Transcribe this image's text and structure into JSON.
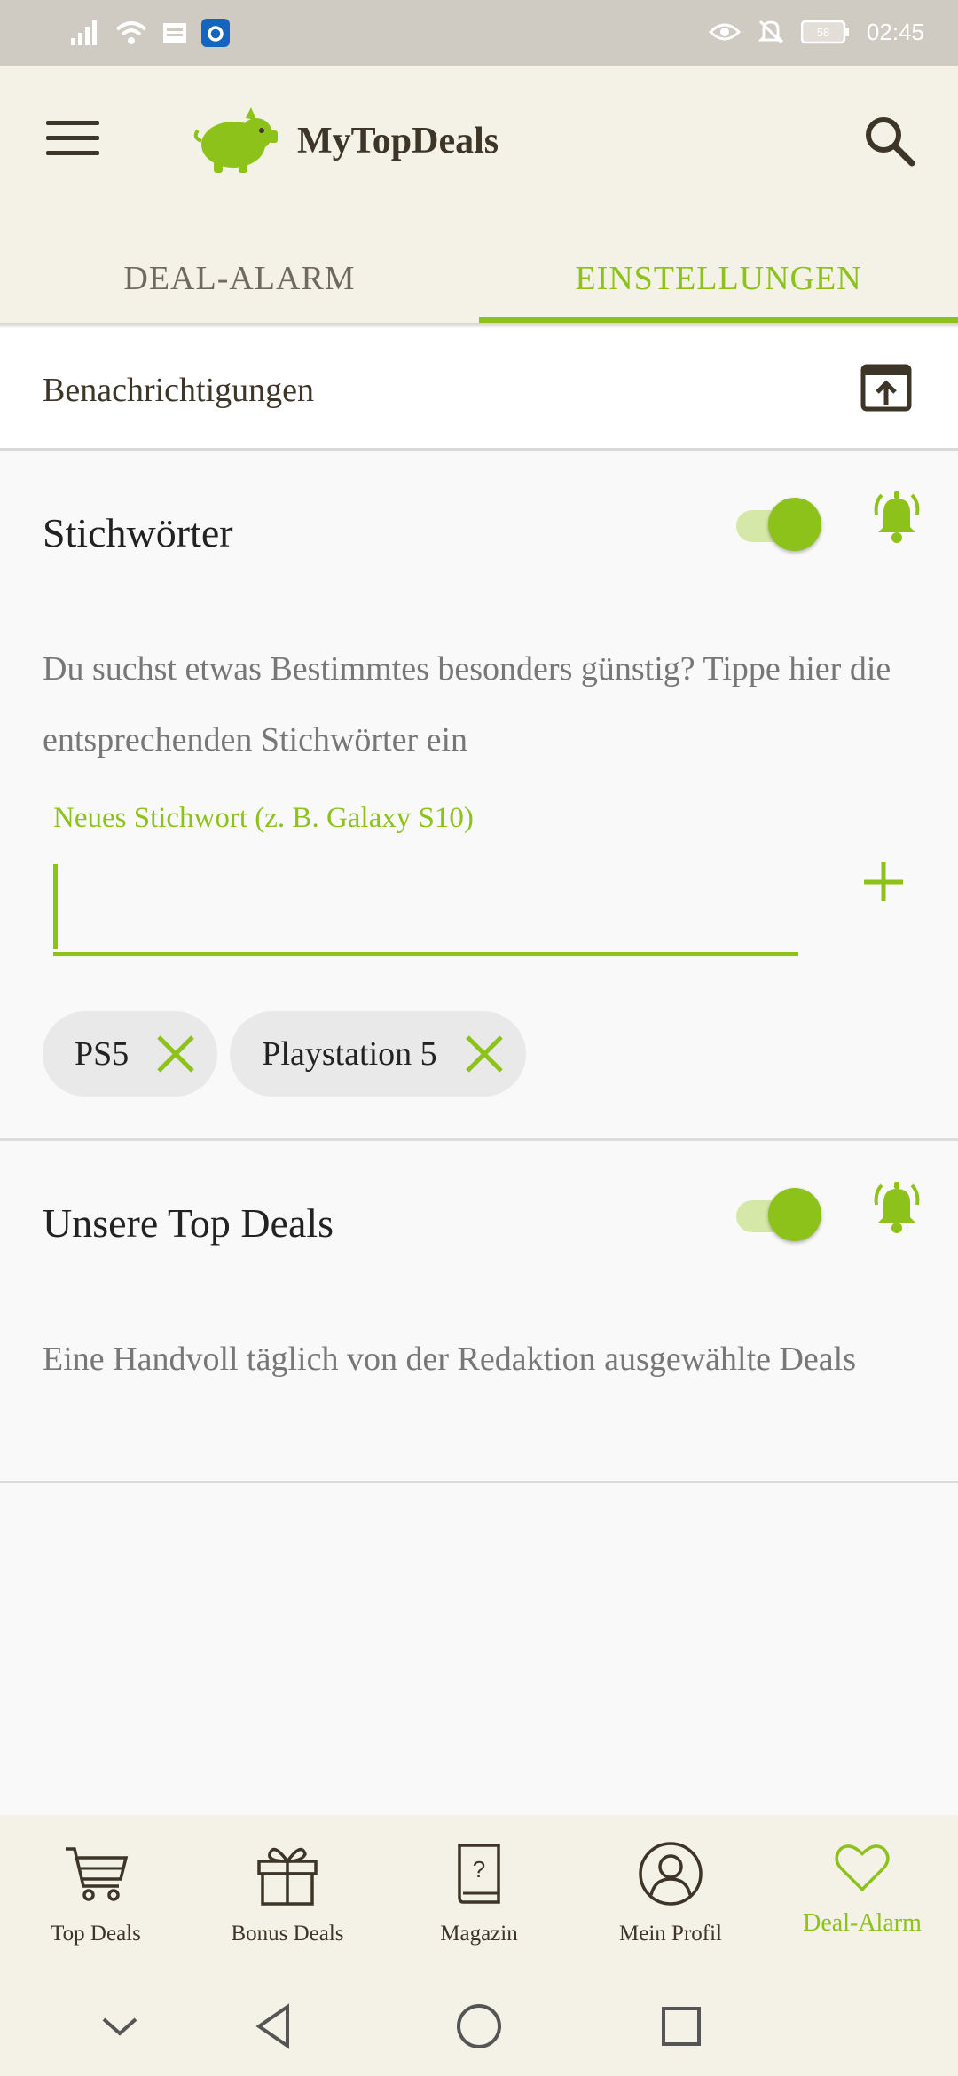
{
  "status_bar": {
    "time": "02:45",
    "battery": "58",
    "icons": [
      "signal-icon",
      "wifi-icon",
      "message-icon",
      "app-icon",
      "eye-icon",
      "bell-off-icon",
      "battery-icon"
    ]
  },
  "app_bar": {
    "brand": "MyTopDeals",
    "menu_icon": "menu-icon",
    "search_icon": "search-icon"
  },
  "tabs": [
    {
      "label": "DEAL-ALARM",
      "active": false
    },
    {
      "label": "EINSTELLUNGEN",
      "active": true
    }
  ],
  "notifications": {
    "label": "Benachrichtigungen",
    "icon": "open-settings-icon"
  },
  "keywords_section": {
    "title": "Stichwörter",
    "enabled": true,
    "description": "Du suchst etwas Bestimmtes besonders günstig? Tippe hier die entsprechenden Stichwörter ein",
    "input_label": "Neues Stichwort (z. B. Galaxy S10)",
    "input_value": "",
    "chips": [
      "PS5",
      "Playstation 5"
    ]
  },
  "top_deals_section": {
    "title": "Unsere Top Deals",
    "enabled": true,
    "description": "Eine Handvoll täglich von der Redaktion ausgewählte Deals"
  },
  "bottom_nav": [
    {
      "label": "Top Deals",
      "icon": "cart-icon",
      "active": false
    },
    {
      "label": "Bonus Deals",
      "icon": "gift-icon",
      "active": false
    },
    {
      "label": "Magazin",
      "icon": "book-icon",
      "active": false
    },
    {
      "label": "Mein Profil",
      "icon": "profile-icon",
      "active": false
    },
    {
      "label": "Deal-Alarm",
      "icon": "heart-icon",
      "active": true
    }
  ],
  "colors": {
    "accent": "#8cc21a",
    "header_bg": "#f4f1e6",
    "dark_text": "#3d3528"
  }
}
